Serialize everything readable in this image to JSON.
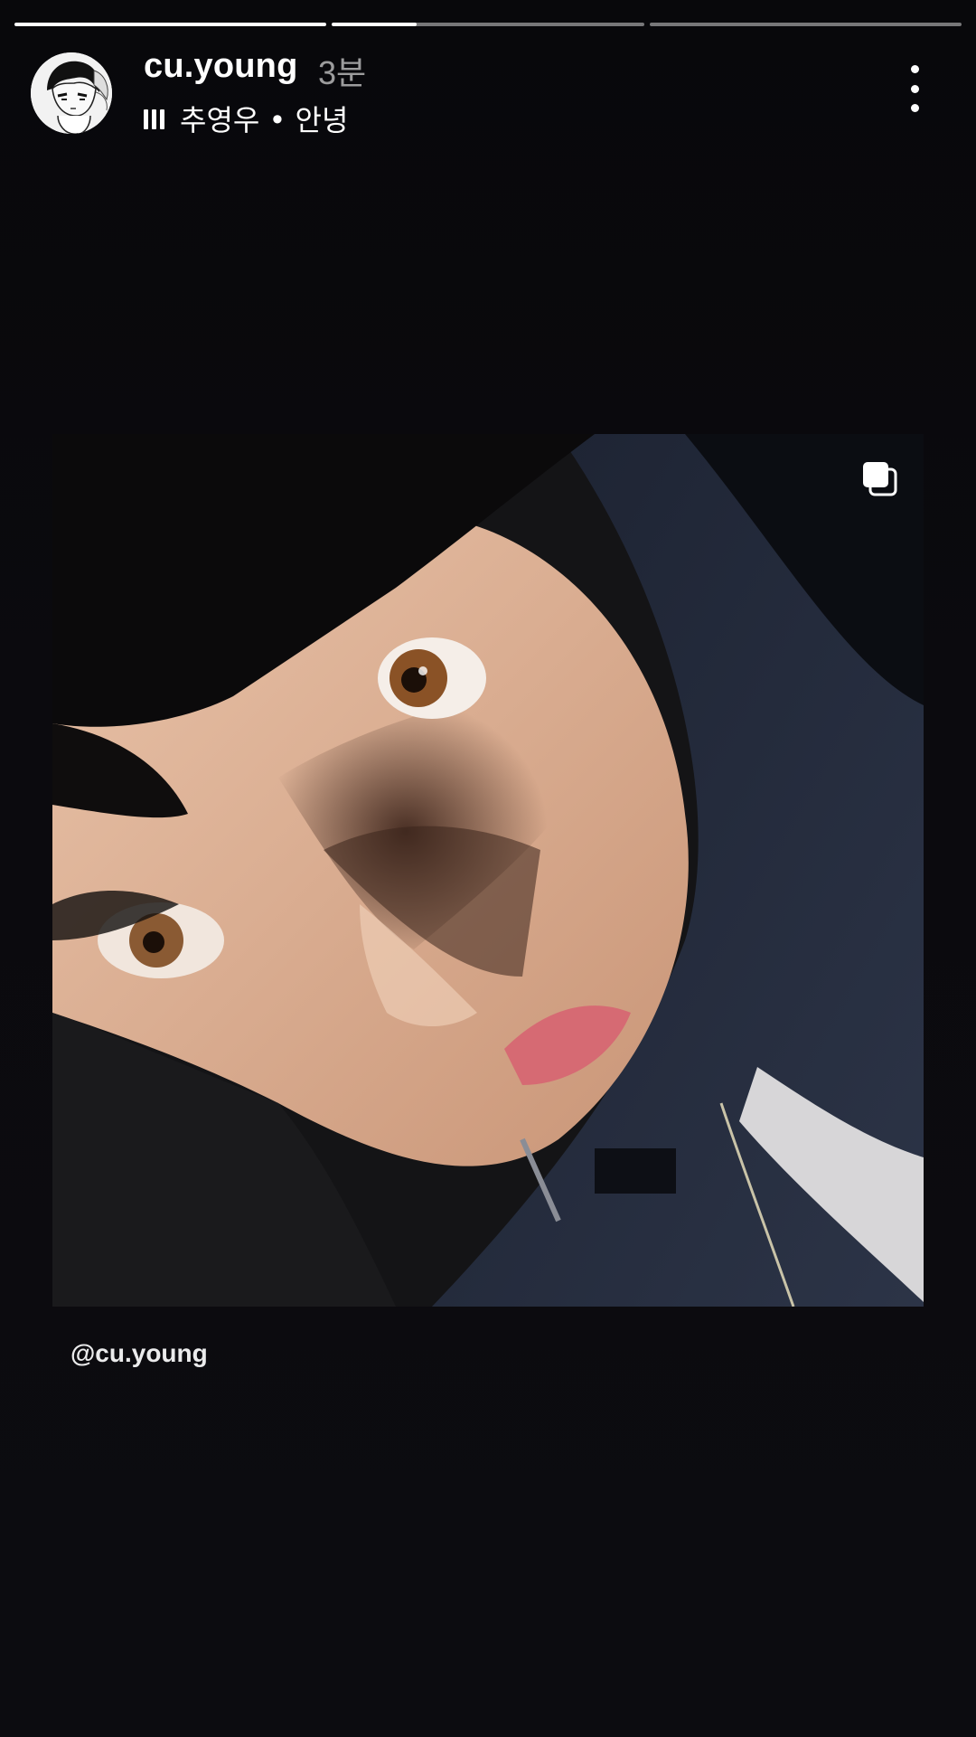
{
  "story": {
    "progress": [
      1.0,
      0.27,
      0.0
    ],
    "username": "cu.young",
    "time_ago": "3분",
    "music": {
      "icon": "music-bars-icon",
      "text": "추영우 • 안녕"
    },
    "more_icon": "more-vertical-icon",
    "photo_icon": "carousel-multiple-icon",
    "mention": "@cu.young"
  }
}
